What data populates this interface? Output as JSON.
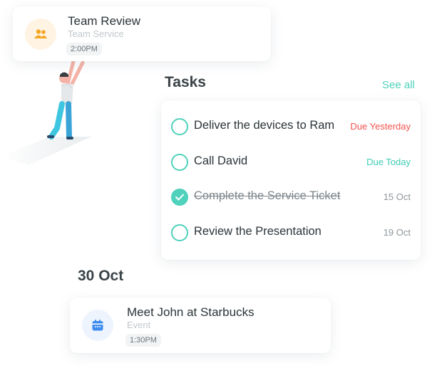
{
  "top_event": {
    "title": "Team Review",
    "subtitle": "Team Service",
    "time": "2:00PM",
    "icon": "people-icon",
    "icon_color": "#f5a623",
    "icon_bg": "#fff4e4"
  },
  "tasks": {
    "heading": "Tasks",
    "see_all": "See all",
    "items": [
      {
        "label": "Deliver the devices to Ram",
        "due": "Due Yesterday",
        "due_color": "#f2534e",
        "done": false
      },
      {
        "label": "Call David",
        "due": "Due Today",
        "due_color": "#3ecbb3",
        "done": false
      },
      {
        "label": "Complete the Service Ticket",
        "due": "15 Oct",
        "due_color": "#8f969b",
        "done": true
      },
      {
        "label": "Review the Presentation",
        "due": "19 Oct",
        "due_color": "#8f969b",
        "done": false
      }
    ],
    "accent": "#4fd1bb"
  },
  "date_heading": "30 Oct",
  "bottom_event": {
    "title": "Meet John at Starbucks",
    "subtitle": "Event",
    "time": "1:30PM",
    "icon": "calendar-icon",
    "icon_color": "#3f8cf0",
    "icon_bg": "#eef4fd"
  },
  "illustration": "person-reaching-up-illustration"
}
